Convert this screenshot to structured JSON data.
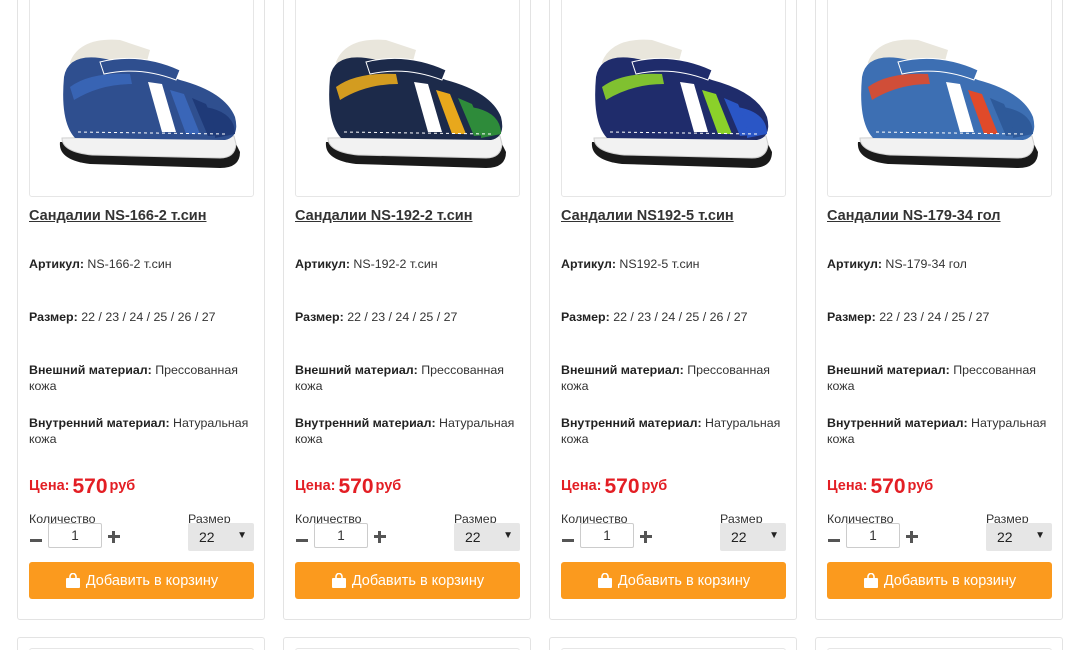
{
  "products": [
    {
      "title": "Сандалии NS-166-2 т.син",
      "article_label": "Артикул:",
      "article": "NS-166-2 т.син",
      "size_label": "Размер:",
      "sizes": "22 / 23 / 24 / 25 / 26 / 27",
      "outer_label": "Внешний материал:",
      "outer": "Прессованная кожа",
      "inner_label": "Внутренний материал:",
      "inner": "Натуральная кожа",
      "price_label": "Цена:",
      "price": "570",
      "currency": "руб",
      "qty_label": "Количество",
      "qty": "1",
      "size_select_label": "Размер",
      "size_selected": "22",
      "cart_label": "Добавить в корзину",
      "colors": {
        "main": "#2f4f8f",
        "accent": "#3a66b8",
        "stripe1": "#ffffff",
        "stripe2": "#1f3a78"
      }
    },
    {
      "title": "Сандалии NS-192-2 т.син",
      "article_label": "Артикул:",
      "article": "NS-192-2 т.син",
      "size_label": "Размер:",
      "sizes": "22 / 23 / 24 / 25 / 27",
      "outer_label": "Внешний материал:",
      "outer": "Прессованная кожа",
      "inner_label": "Внутренний материал:",
      "inner": "Натуральная кожа",
      "price_label": "Цена:",
      "price": "570",
      "currency": "руб",
      "qty_label": "Количество",
      "qty": "1",
      "size_select_label": "Размер",
      "size_selected": "22",
      "cart_label": "Добавить в корзину",
      "colors": {
        "main": "#1c2a4a",
        "accent": "#e8a81c",
        "stripe1": "#ffffff",
        "stripe2": "#2e8b3a"
      }
    },
    {
      "title": "Сандалии NS192-5 т.син",
      "article_label": "Артикул:",
      "article": "NS192-5 т.син",
      "size_label": "Размер:",
      "sizes": "22 / 23 / 24 / 25 / 26 / 27",
      "outer_label": "Внешний материал:",
      "outer": "Прессованная кожа",
      "inner_label": "Внутренний материал:",
      "inner": "Натуральная кожа",
      "price_label": "Цена:",
      "price": "570",
      "currency": "руб",
      "qty_label": "Количество",
      "qty": "1",
      "size_select_label": "Размер",
      "size_selected": "22",
      "cart_label": "Добавить в корзину",
      "colors": {
        "main": "#1f2c6b",
        "accent": "#8bd12a",
        "stripe1": "#ffffff",
        "stripe2": "#2a56c6"
      }
    },
    {
      "title": "Сандалии NS-179-34 гол",
      "article_label": "Артикул:",
      "article": "NS-179-34 гол",
      "size_label": "Размер:",
      "sizes": "22 / 23 / 24 / 25 / 27",
      "outer_label": "Внешний материал:",
      "outer": "Прессованная кожа",
      "inner_label": "Внутренний материал:",
      "inner": "Натуральная кожа",
      "price_label": "Цена:",
      "price": "570",
      "currency": "руб",
      "qty_label": "Количество",
      "qty": "1",
      "size_select_label": "Размер",
      "size_selected": "22",
      "cart_label": "Добавить в корзину",
      "colors": {
        "main": "#3d6fb3",
        "accent": "#e04a2a",
        "stripe1": "#ffffff",
        "stripe2": "#2e5a9a"
      }
    }
  ],
  "theme": {
    "price_color": "#e31e24",
    "button_color": "#fb9a1e",
    "button_text": "#ffffff"
  },
  "icons": {
    "cart": "shopping-bag-icon",
    "minus": "minus-icon",
    "plus": "plus-icon",
    "select": "chevron-down-icon"
  }
}
